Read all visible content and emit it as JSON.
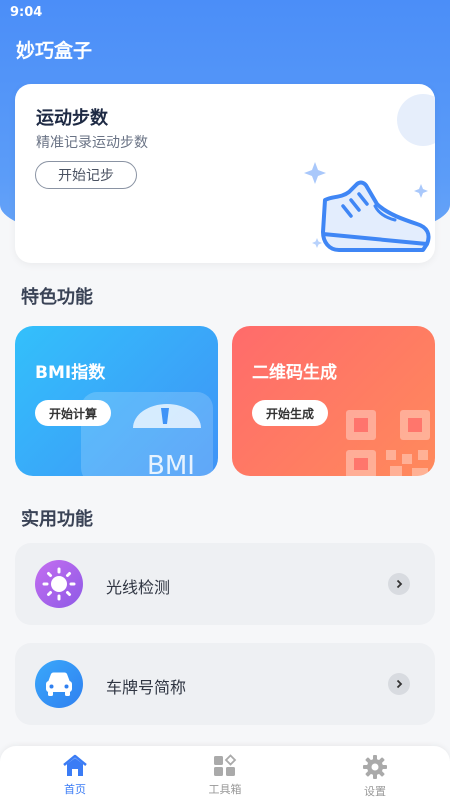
{
  "status_bar": {
    "time": "9:04"
  },
  "app": {
    "title": "妙巧盒子"
  },
  "hero": {
    "title": "运动步数",
    "subtitle": "精准记录运动步数",
    "button_label": "开始记步"
  },
  "sections": {
    "featured_title": "特色功能",
    "utility_title": "实用功能"
  },
  "featured": [
    {
      "title": "BMI指数",
      "button_label": "开始计算",
      "art_text": "BMI"
    },
    {
      "title": "二维码生成",
      "button_label": "开始生成"
    }
  ],
  "utilities": [
    {
      "label": "光线检测",
      "icon": "sun-icon"
    },
    {
      "label": "车牌号简称",
      "icon": "car-icon"
    }
  ],
  "nav": [
    {
      "label": "首页",
      "icon": "home-icon",
      "active": true
    },
    {
      "label": "工具箱",
      "icon": "toolbox-icon",
      "active": false
    },
    {
      "label": "设置",
      "icon": "gear-icon",
      "active": false
    }
  ],
  "colors": {
    "primary": "#4b8ef8",
    "bmi_card": "#33c0fb",
    "qr_card": "#ff6b6b",
    "nav_active": "#3b7cf5"
  }
}
